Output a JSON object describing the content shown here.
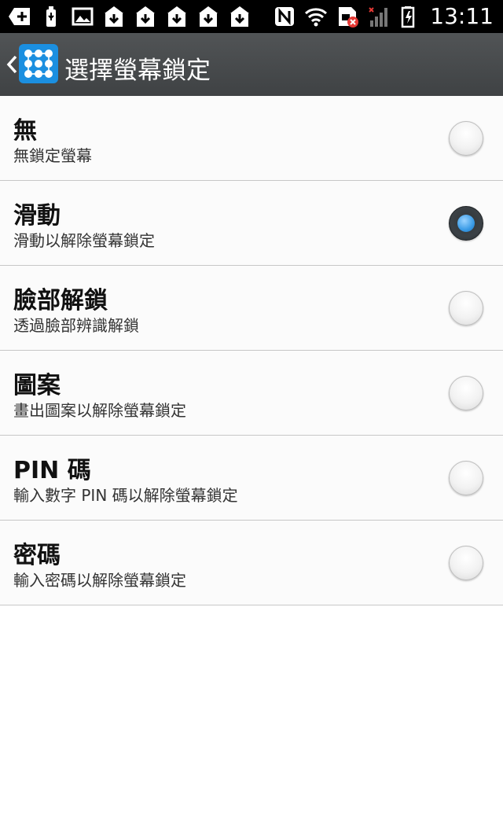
{
  "status_bar": {
    "time": "13:11",
    "icons_left": [
      "add-notification-icon",
      "usb-icon",
      "image-icon",
      "download-icon",
      "download-icon",
      "download-icon",
      "download-icon",
      "download-icon"
    ],
    "icons_right": [
      "nfc-icon",
      "wifi-icon",
      "sim-error-icon",
      "signal-icon",
      "battery-charging-icon"
    ]
  },
  "app_bar": {
    "title": "選擇螢幕鎖定"
  },
  "options": [
    {
      "title": "無",
      "subtitle": "無鎖定螢幕",
      "selected": false
    },
    {
      "title": "滑動",
      "subtitle": "滑動以解除螢幕鎖定",
      "selected": true
    },
    {
      "title": "臉部解鎖",
      "subtitle": "透過臉部辨識解鎖",
      "selected": false
    },
    {
      "title": "圖案",
      "subtitle": "畫出圖案以解除螢幕鎖定",
      "selected": false
    },
    {
      "title": "PIN 碼",
      "subtitle": "輸入數字 PIN 碼以解除螢幕鎖定",
      "selected": false
    },
    {
      "title": "密碼",
      "subtitle": "輸入密碼以解除螢幕鎖定",
      "selected": false
    }
  ],
  "colors": {
    "accent": "#3a9be6",
    "appbar": "#4a4d50"
  }
}
